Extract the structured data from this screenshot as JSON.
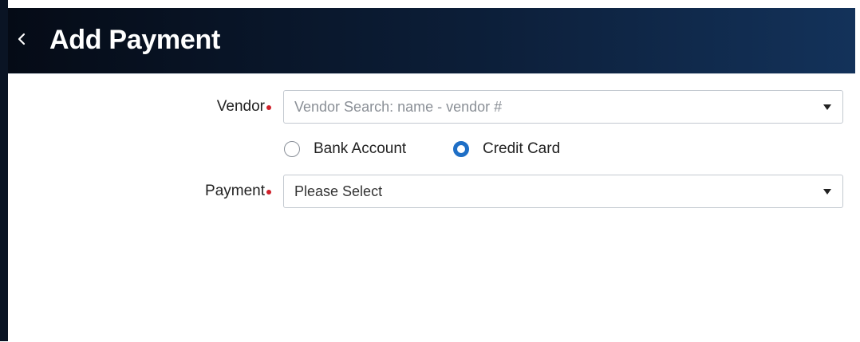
{
  "header": {
    "title": "Add Payment",
    "back_icon": "chevron-left-icon"
  },
  "form": {
    "vendor": {
      "label": "Vendor",
      "placeholder": "Vendor Search: name - vendor #",
      "caret_icon": "caret-down-icon"
    },
    "payment_type": {
      "options": [
        {
          "label": "Bank Account",
          "selected": false
        },
        {
          "label": "Credit Card",
          "selected": true
        }
      ]
    },
    "payment": {
      "label": "Payment",
      "value": "Please Select",
      "caret_icon": "caret-down-icon"
    }
  },
  "colors": {
    "header_dark": "#050b16",
    "header_light": "#13325a",
    "required_dot": "#d0202a",
    "radio_selected": "#1f6fc6",
    "border": "#c3c9d0"
  }
}
